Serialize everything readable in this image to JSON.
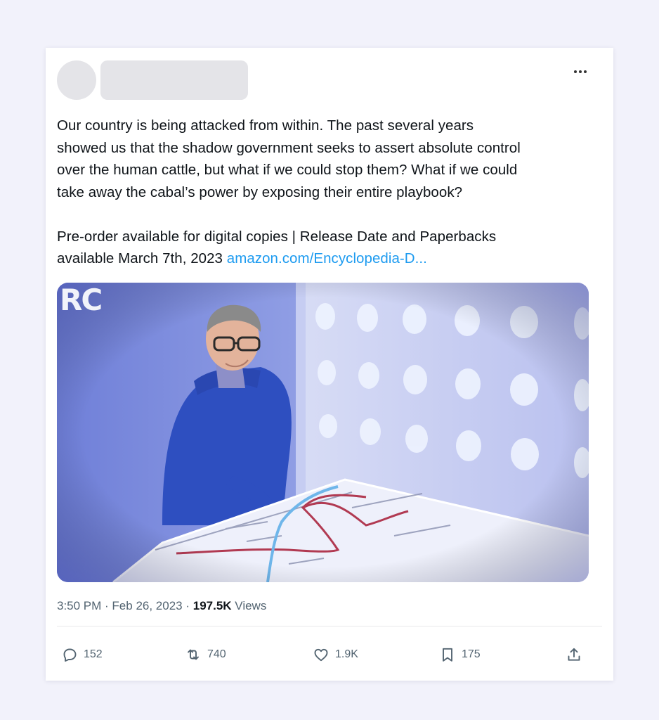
{
  "tweet": {
    "text_lines": [
      "Our country is being attacked from within. The past several years",
      "showed us that the shadow government seeks to assert absolute control",
      "over the human cattle, but what if we could stop them? What if we could",
      "take away the cabal’s power by exposing their entire playbook?"
    ],
    "text2_line1": "Pre-order available for digital copies | Release Date and Paperbacks",
    "text2_line2_prefix": "available March 7th, 2023 ",
    "link_text": "amazon.com/Encyclopedia-D...",
    "link_color": "#1d9bf0"
  },
  "media": {
    "watermark": "RC"
  },
  "meta": {
    "time": "3:50 PM",
    "separator": " · ",
    "date": "Feb 26, 2023",
    "views_count": "197.5K",
    "views_label": "Views"
  },
  "actions": {
    "replies": "152",
    "reposts": "740",
    "likes": "1.9K",
    "bookmarks": "175"
  },
  "icons": {
    "more": "more-horizontal-icon",
    "reply": "reply-icon",
    "repost": "repost-icon",
    "like": "heart-icon",
    "bookmark": "bookmark-icon",
    "share": "share-icon"
  }
}
